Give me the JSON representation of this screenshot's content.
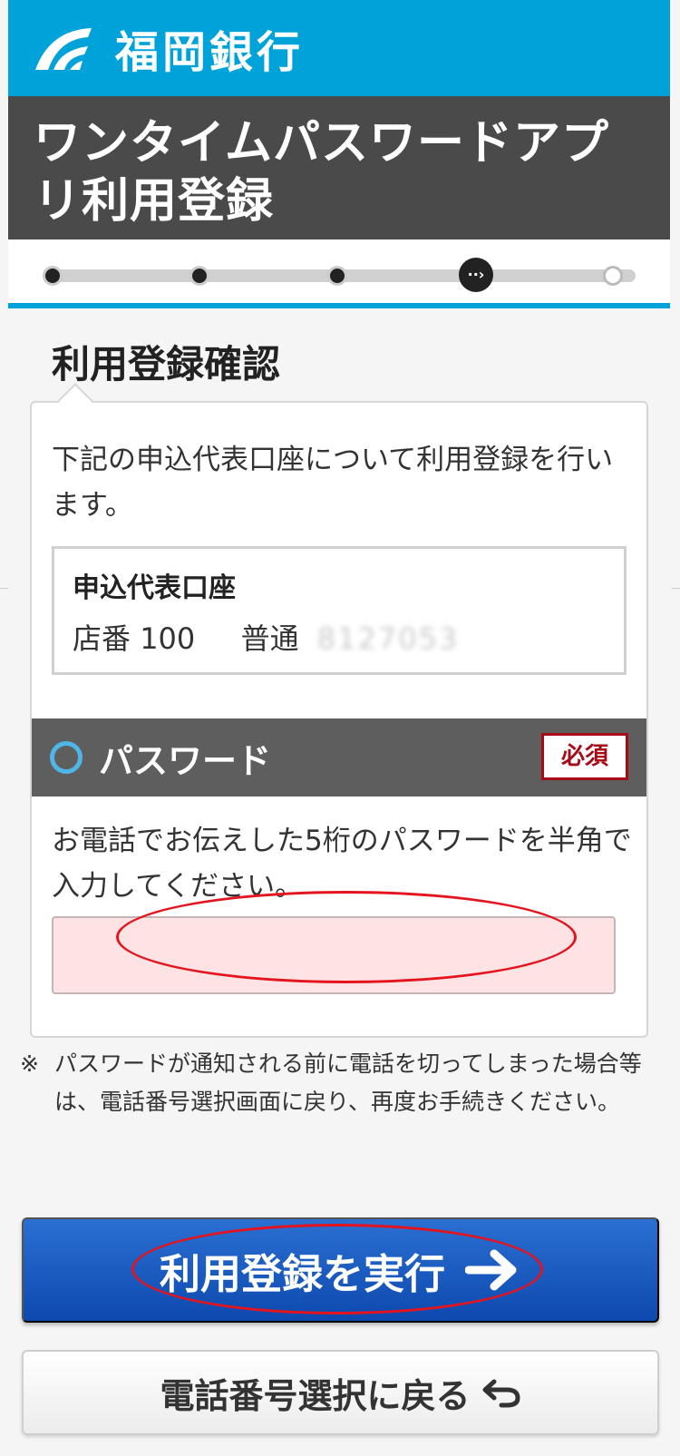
{
  "header": {
    "bank_name": "福岡銀行",
    "logo_icon": "fukuoka-bank-logo",
    "brand_color": "#00a3d9"
  },
  "title": {
    "line1": "ワンタイムパスワードアプ",
    "line2": "リ利用登録"
  },
  "progress": {
    "steps_total": 5,
    "current_step": 4,
    "current_icon": "step-arrow-icon"
  },
  "section": {
    "heading": "利用登録確認",
    "intro": "下記の申込代表口座について利用登録を行います。"
  },
  "account": {
    "heading": "申込代表口座",
    "branch_label": "店番",
    "branch_no": "100",
    "type": "普通",
    "number": "8127053"
  },
  "password": {
    "label": "パスワード",
    "required_badge": "必須",
    "description": "お電話でお伝えした5桁のパスワードを半角で入力してください。",
    "value": "",
    "placeholder": "",
    "input_bg": "#fde3e4"
  },
  "note": {
    "mark": "※",
    "text": "パスワードが通知される前に電話を切ってしまった場合等は、電話番号選択画面に戻り、再度お手続きください。"
  },
  "actions": {
    "submit_label": "利用登録を実行",
    "submit_icon": "arrow-right-icon",
    "back_label": "電話番号選択に戻る",
    "back_icon": "return-arrow-icon"
  },
  "annotation_color": "#e4141e"
}
